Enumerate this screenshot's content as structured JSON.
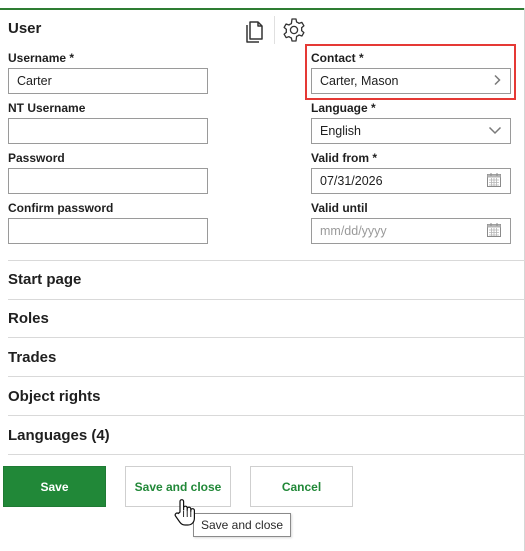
{
  "user_section": {
    "title": "User",
    "toolbar": {
      "copy_icon": "copy-icon",
      "settings_icon": "gear-icon"
    }
  },
  "fields": {
    "username": {
      "label": "Username *",
      "value": "Carter"
    },
    "nt_username": {
      "label": "NT Username",
      "value": ""
    },
    "password": {
      "label": "Password",
      "value": ""
    },
    "confirm_password": {
      "label": "Confirm password",
      "value": ""
    },
    "contact": {
      "label": "Contact *",
      "value": "Carter, Mason",
      "icon": "chevron-right-icon",
      "highlight_color": "#e53935"
    },
    "language": {
      "label": "Language *",
      "value": "English",
      "icon": "chevron-down-icon"
    },
    "valid_from": {
      "label": "Valid from *",
      "value": "07/31/2026",
      "icon": "calendar-icon"
    },
    "valid_until": {
      "label": "Valid until",
      "placeholder": "mm/dd/yyyy",
      "icon": "calendar-icon"
    }
  },
  "sections": [
    {
      "title": "Start page"
    },
    {
      "title": "Roles"
    },
    {
      "title": "Trades"
    },
    {
      "title": "Object rights"
    },
    {
      "title": "Languages (4)"
    }
  ],
  "actions": {
    "save": "Save",
    "save_and_close": "Save and close",
    "cancel": "Cancel"
  },
  "tooltip": {
    "text": "Save and close"
  },
  "colors": {
    "accent": "#218838",
    "divider": "#d9d9d9",
    "highlight": "#e53935"
  }
}
